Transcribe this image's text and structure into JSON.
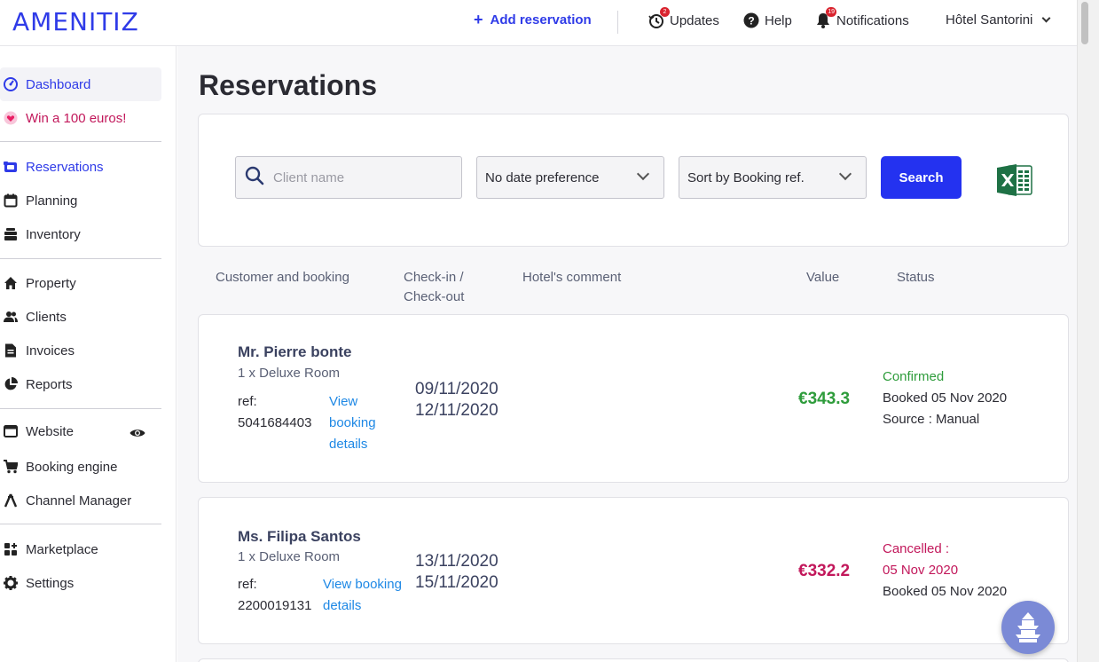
{
  "brand": {
    "logo": "AMENITIZ",
    "accent": "#2f3be8"
  },
  "header": {
    "add_reservation": "Add reservation",
    "updates": "Updates",
    "updates_badge": "2",
    "help": "Help",
    "notifications": "Notifications",
    "notifications_badge": "19",
    "hotel": "Hôtel Santorini"
  },
  "sidebar": {
    "dashboard": "Dashboard",
    "promo": "Win a 100 euros!",
    "reservations": "Reservations",
    "planning": "Planning",
    "inventory": "Inventory",
    "property": "Property",
    "clients": "Clients",
    "invoices": "Invoices",
    "reports": "Reports",
    "website": "Website",
    "booking_engine": "Booking engine",
    "channel_manager": "Channel Manager",
    "marketplace": "Marketplace",
    "settings": "Settings"
  },
  "page": {
    "title": "Reservations"
  },
  "filters": {
    "search_placeholder": "Client name",
    "date_pref": "No date preference",
    "sort": "Sort by Booking ref.",
    "search_button": "Search"
  },
  "columns": {
    "customer": "Customer and booking",
    "checkin": "Check-in /",
    "checkout": "Check-out",
    "comment": "Hotel's comment",
    "value": "Value",
    "status": "Status"
  },
  "reservations": [
    {
      "name": "Mr. Pierre bonte",
      "room": "1 x Deluxe Room",
      "ref_label": "ref:",
      "ref": "5041684403",
      "link1": "View",
      "link2": "booking",
      "link3": "details",
      "checkin": "09/11/2020",
      "checkout": "12/11/2020",
      "value": "€343.3",
      "status": "Confirmed",
      "booked": "Booked 05 Nov 2020",
      "source": "Source : Manual"
    },
    {
      "name": "Ms. Filipa Santos",
      "room": "1 x Deluxe Room",
      "ref_label": "ref:",
      "ref": "2200019131",
      "link1": "View booking",
      "link2": "details",
      "checkin": "13/11/2020",
      "checkout": "15/11/2020",
      "value": "€332.2",
      "status": "Cancelled :",
      "cancel_date": "05 Nov 2020",
      "booked": "Booked 05 Nov 2020"
    }
  ]
}
